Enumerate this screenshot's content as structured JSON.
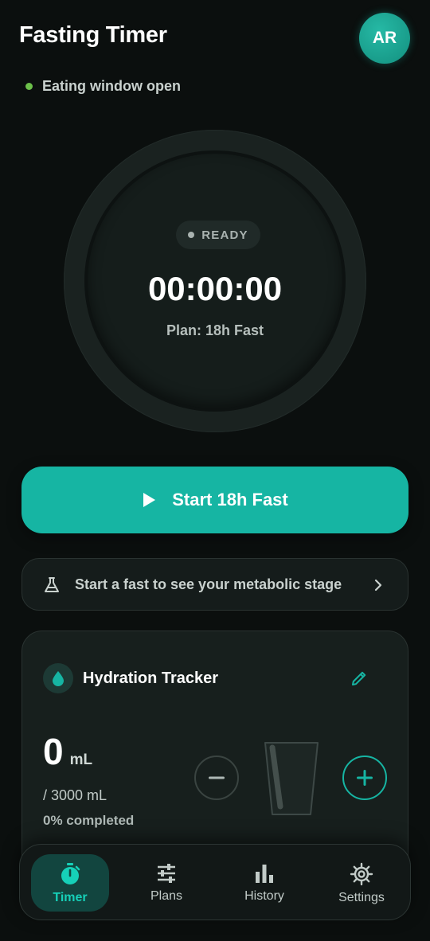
{
  "header": {
    "title": "Fasting Timer",
    "avatar_initials": "AR",
    "status": "Eating window open"
  },
  "timer": {
    "state": "READY",
    "display": "00:00:00",
    "plan": "Plan: 18h Fast"
  },
  "actions": {
    "start_label": "Start 18h Fast",
    "stage_banner": "Start a fast to see your metabolic stage"
  },
  "hydration": {
    "title": "Hydration Tracker",
    "amount": "0",
    "unit": "mL",
    "goal": "/ 3000 mL",
    "completed": "0% completed",
    "progress": 0
  },
  "nav": {
    "items": [
      {
        "label": "Timer",
        "icon": "stopwatch-icon",
        "active": true
      },
      {
        "label": "Plans",
        "icon": "sliders-icon",
        "active": false
      },
      {
        "label": "History",
        "icon": "bar-chart-icon",
        "active": false
      },
      {
        "label": "Settings",
        "icon": "gear-icon",
        "active": false
      }
    ]
  },
  "colors": {
    "accent": "#16b5a3",
    "status_green": "#6cc04a",
    "background": "#0b0f0e"
  }
}
